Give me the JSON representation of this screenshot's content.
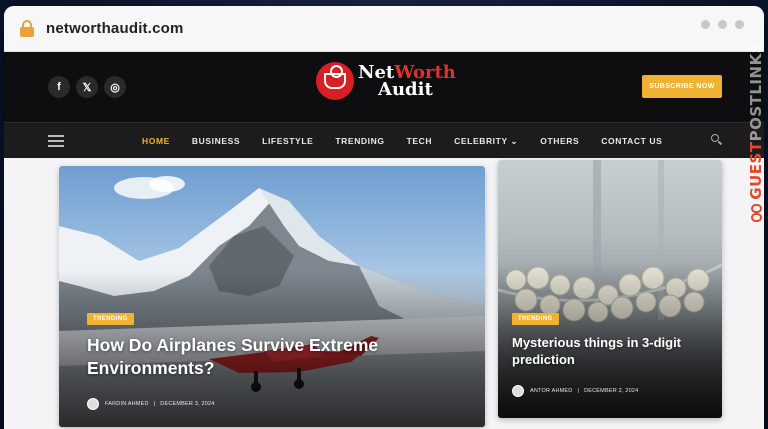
{
  "browser": {
    "url": "networthaudit.com"
  },
  "header": {
    "socials": [
      {
        "icon": "facebook-icon",
        "glyph": "f"
      },
      {
        "icon": "x-twitter-icon",
        "glyph": "𝕏"
      },
      {
        "icon": "instagram-icon",
        "glyph": "◎"
      }
    ],
    "logo_line1_a": "Net",
    "logo_line1_b": "Worth",
    "logo_line2": "Audit",
    "subscribe_label": "SUBSCRIBE NOW"
  },
  "nav": {
    "items": [
      {
        "label": "HOME",
        "active": true
      },
      {
        "label": "BUSINESS"
      },
      {
        "label": "LIFESTYLE"
      },
      {
        "label": "TRENDING"
      },
      {
        "label": "TECH"
      },
      {
        "label": "CELEBRITY ⌄"
      },
      {
        "label": "OTHERS"
      },
      {
        "label": "CONTACT US"
      }
    ]
  },
  "articles": [
    {
      "badge": "TRENDING",
      "title": "How Do Airplanes Survive Extreme Environments?",
      "author": "FARDIN AHMED",
      "date": "DECEMBER 3, 2024"
    },
    {
      "badge": "TRENDING",
      "title": "Mysterious things in 3-digit prediction",
      "author": "ANTOR AHMED",
      "date": "DECEMBER 2, 2024"
    }
  ],
  "watermark": {
    "part1": "GUEST",
    "part2": "POSTLINKS"
  },
  "colors": {
    "accent": "#f0b232",
    "brand_red": "#d71f26"
  }
}
